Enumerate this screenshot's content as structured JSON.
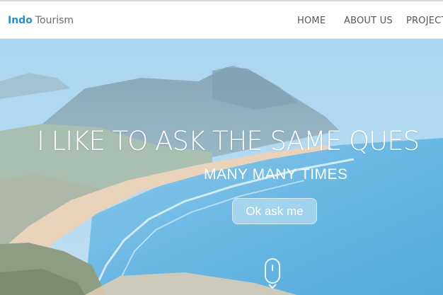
{
  "navbar": {
    "brand_primary": "Indo",
    "brand_secondary": "Tourism",
    "links": [
      "HOME",
      "ABOUT US",
      "PROJECT"
    ]
  },
  "hero": {
    "headline": "I LIKE TO ASK THE SAME QUES",
    "subline": "MANY MANY TIMES",
    "cta_label": "Ok ask me",
    "scroll_indicator_icon": "mouse-scroll-icon"
  },
  "colors": {
    "brand_accent": "#2b8fd4",
    "nav_text": "#555555",
    "hero_sea": "#5fb6e6",
    "hero_sky": "#a7d1ee"
  }
}
